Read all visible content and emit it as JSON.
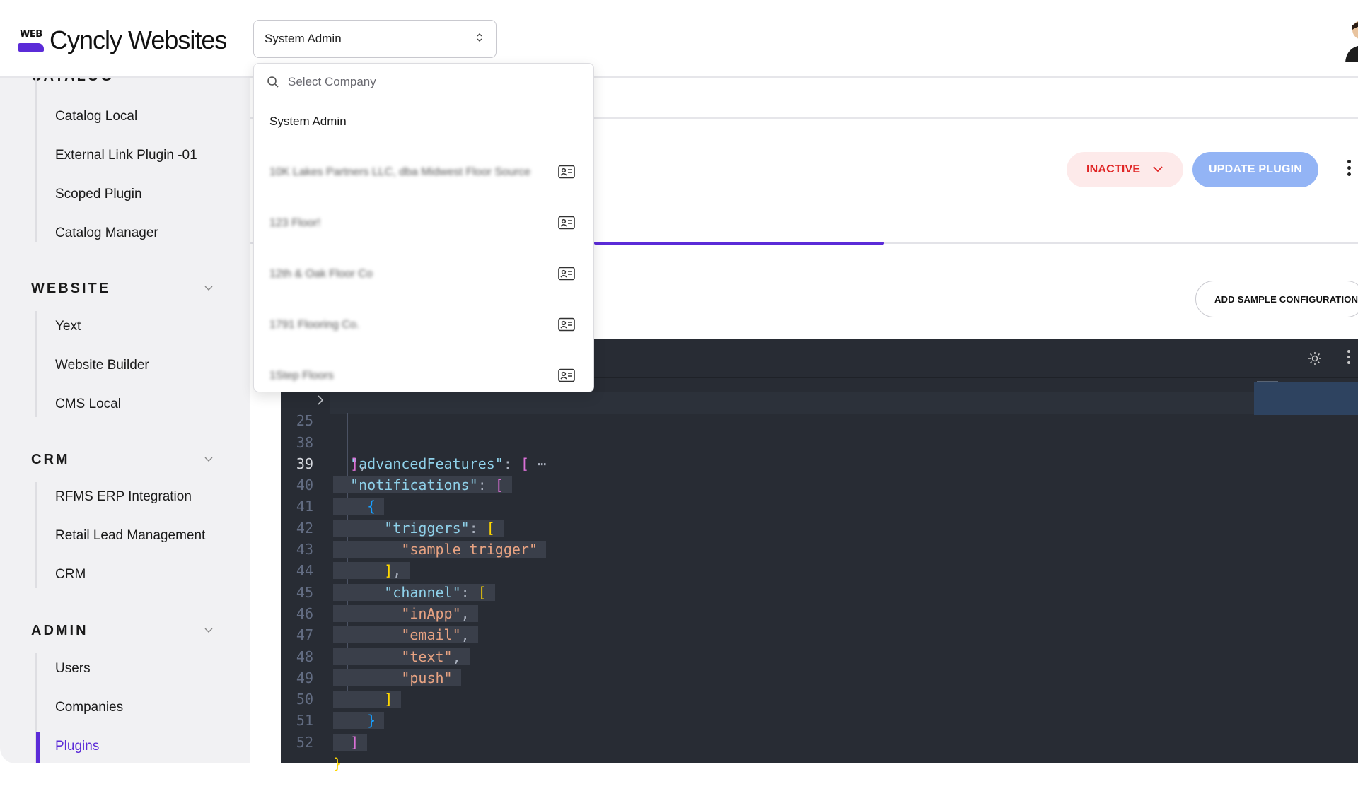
{
  "header": {
    "logo_badge": "WEB",
    "logo_text": "Cyncly Websites",
    "company_select_value": "System Admin"
  },
  "sidebar": {
    "catalog": {
      "title": "CATALOG",
      "items": [
        "Catalog Local",
        "External Link Plugin -01",
        "Scoped Plugin",
        "Catalog Manager"
      ]
    },
    "website": {
      "title": "WEBSITE",
      "items": [
        "Yext",
        "Website Builder",
        "CMS Local"
      ]
    },
    "crm": {
      "title": "CRM",
      "items": [
        "RFMS ERP Integration",
        "Retail Lead Management",
        "CRM"
      ]
    },
    "admin": {
      "title": "ADMIN",
      "items": [
        "Users",
        "Companies",
        "Plugins"
      ]
    },
    "active_item": "Plugins"
  },
  "main": {
    "status_label": "INACTIVE",
    "update_label": "UPDATE PLUGIN",
    "sample_config_label": "ADD SAMPLE CONFIGURATION"
  },
  "dropdown": {
    "search_placeholder": "Select Company",
    "options": [
      "System Admin",
      "10K Lakes Partners LLC, dba Midwest Floor Source",
      "123 Floor!",
      "12th & Oak Floor Co",
      "1791 Flooring Co.",
      "1Step Floors"
    ]
  },
  "editor": {
    "line_numbers": [
      "25",
      "38",
      "39",
      "40",
      "41",
      "42",
      "43",
      "44",
      "45",
      "46",
      "47",
      "48",
      "49",
      "50",
      "51",
      "52"
    ],
    "current_line": "39",
    "keys": [
      "\"advancedFeatures\"",
      "\"notifications\"",
      "\"triggers\"",
      "\"channel\""
    ],
    "strings": [
      "\"sample trigger\"",
      "\"inApp\"",
      "\"email\"",
      "\"text\"",
      "\"push\""
    ],
    "folded_marker": "⋯"
  },
  "colors": {
    "accent": "#5b2bd8",
    "inactive_bg": "#fdeaea",
    "inactive_text": "#e02424",
    "update_bg": "#93b4f5",
    "editor_bg": "#282c34"
  },
  "icons": [
    "search-icon",
    "id-card-icon",
    "chevron-down-icon",
    "chevron-updown-icon",
    "sun-icon",
    "kebab-icon",
    "fold-chevron-icon"
  ]
}
